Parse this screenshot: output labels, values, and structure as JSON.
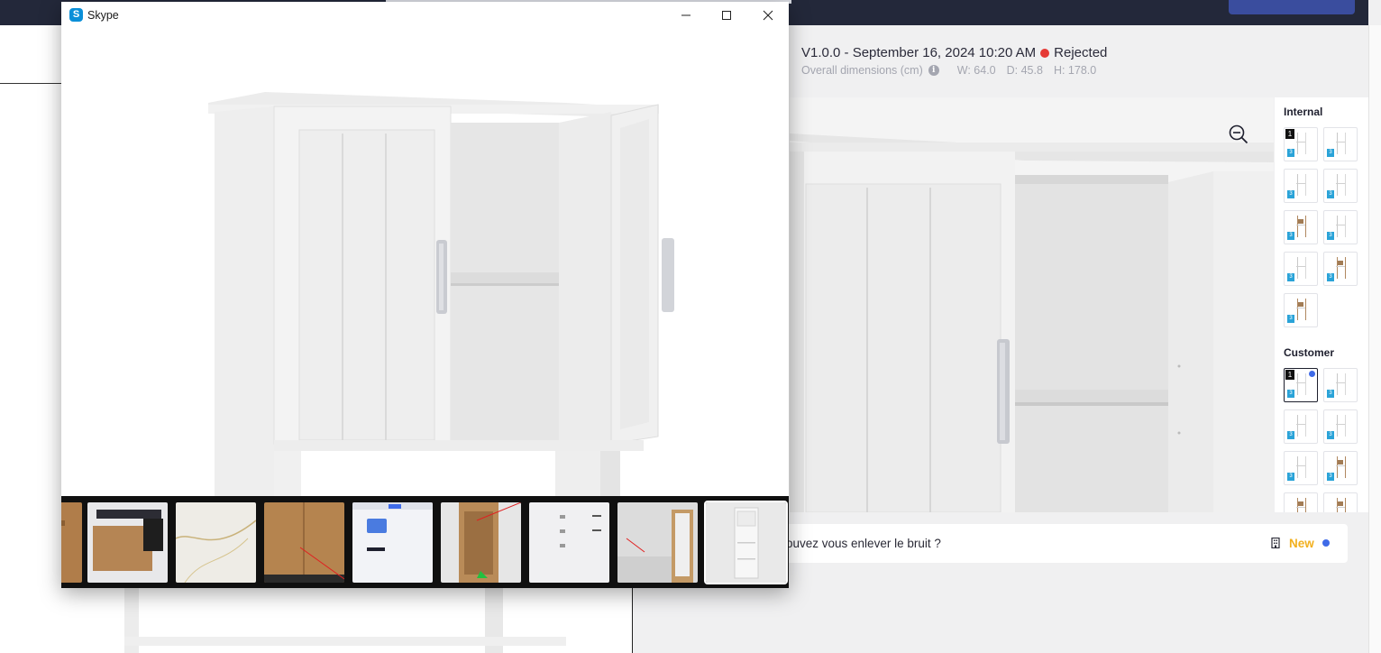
{
  "version": {
    "label": "V1.0.0 - September 16, 2024 10:20 AM",
    "status": "Rejected",
    "status_color": "#e53935"
  },
  "dimensions": {
    "label": "Overall dimensions (cm)",
    "width": "W: 64.0",
    "depth": "D: 45.8",
    "height": "H: 178.0"
  },
  "sidebar": {
    "internal_title": "Internal",
    "customer_title": "Customer",
    "badge_label": "3",
    "selected_number": "1"
  },
  "comment": {
    "text": "ouvez vous enlever le bruit ?",
    "status": "New",
    "status_color": "#f2b01e"
  },
  "skype": {
    "title": "Skype",
    "logo_letter": "S"
  },
  "icons": {
    "zoom": "zoom-out-icon",
    "info": "info-icon",
    "building": "building-icon",
    "minimize": "minimize-icon",
    "maximize": "maximize-icon",
    "close": "close-icon"
  },
  "colors": {
    "accent": "#3f6be8",
    "topbar": "#23283a",
    "skype_blue": "#0a8fd8"
  }
}
